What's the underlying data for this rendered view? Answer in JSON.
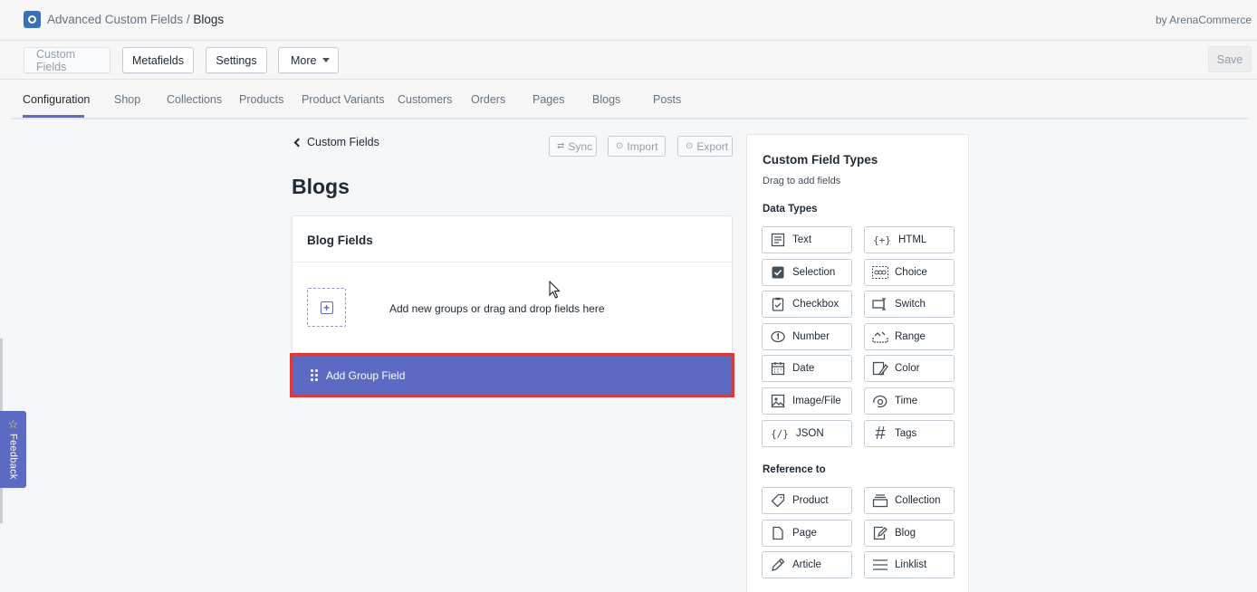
{
  "header": {
    "app_name": "Advanced Custom Fields",
    "separator": " / ",
    "current": "Blogs",
    "byline": "by ArenaCommerce"
  },
  "actions": {
    "custom_fields": "Custom Fields",
    "metafields": "Metafields",
    "settings": "Settings",
    "more": "More",
    "save": "Save"
  },
  "tabs": [
    {
      "label": "Configuration",
      "active": true
    },
    {
      "label": "Shop"
    },
    {
      "label": "Collections"
    },
    {
      "label": "Products"
    },
    {
      "label": "Product Variants"
    },
    {
      "label": "Customers"
    },
    {
      "label": "Orders"
    },
    {
      "label": "Pages"
    },
    {
      "label": "Blogs"
    },
    {
      "label": "Posts"
    }
  ],
  "main": {
    "back_label": "Custom Fields",
    "sync": "Sync",
    "import": "Import",
    "export": "Export",
    "title": "Blogs",
    "card_title": "Blog Fields",
    "drop_text": "Add new groups or drag and drop fields here",
    "group_button": "Add Group Field"
  },
  "panel": {
    "title": "Custom Field Types",
    "subtitle": "Drag to add fields",
    "data_types_title": "Data Types",
    "data_types": [
      {
        "label": "Text",
        "icon": "text-icon"
      },
      {
        "label": "HTML",
        "icon": "html-icon"
      },
      {
        "label": "Selection",
        "icon": "selection-icon"
      },
      {
        "label": "Choice",
        "icon": "choice-icon"
      },
      {
        "label": "Checkbox",
        "icon": "checkbox-icon"
      },
      {
        "label": "Switch",
        "icon": "switch-icon"
      },
      {
        "label": "Number",
        "icon": "number-icon"
      },
      {
        "label": "Range",
        "icon": "range-icon"
      },
      {
        "label": "Date",
        "icon": "date-icon"
      },
      {
        "label": "Color",
        "icon": "color-icon"
      },
      {
        "label": "Image/File",
        "icon": "image-icon"
      },
      {
        "label": "Time",
        "icon": "time-icon"
      },
      {
        "label": "JSON",
        "icon": "json-icon"
      },
      {
        "label": "Tags",
        "icon": "tags-icon"
      }
    ],
    "reference_title": "Reference to",
    "references": [
      {
        "label": "Product",
        "icon": "product-icon"
      },
      {
        "label": "Collection",
        "icon": "collection-icon"
      },
      {
        "label": "Page",
        "icon": "page-icon"
      },
      {
        "label": "Blog",
        "icon": "blog-icon"
      },
      {
        "label": "Article",
        "icon": "article-icon"
      },
      {
        "label": "Linklist",
        "icon": "linklist-icon"
      }
    ]
  },
  "feedback": {
    "label": "Feedback"
  }
}
